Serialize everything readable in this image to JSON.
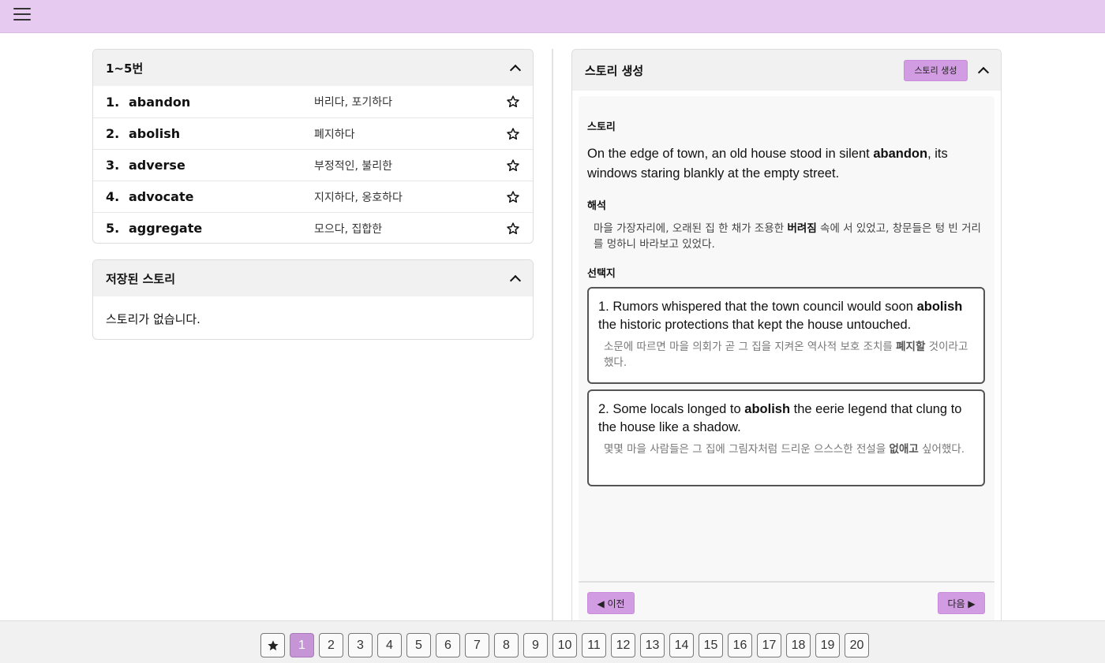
{
  "header": {
    "menu_icon": "hamburger-menu-icon"
  },
  "word_section": {
    "title": "1~5번",
    "words": [
      {
        "num": "1.",
        "word": "abandon",
        "meaning": "버리다, 포기하다"
      },
      {
        "num": "2.",
        "word": "abolish",
        "meaning": "폐지하다"
      },
      {
        "num": "3.",
        "word": "adverse",
        "meaning": "부정적인, 불리한"
      },
      {
        "num": "4.",
        "word": "advocate",
        "meaning": "지지하다, 옹호하다"
      },
      {
        "num": "5.",
        "word": "aggregate",
        "meaning": "모으다, 집합한"
      }
    ]
  },
  "saved_section": {
    "title": "저장된 스토리",
    "empty_text": "스토리가 없습니다."
  },
  "story_panel": {
    "title": "스토리 생성",
    "generate_button": "스토리 생성",
    "story_label": "스토리",
    "story": {
      "before": "On the edge of town, an old house stood in silent ",
      "bold": "abandon",
      "after": ", its windows staring blankly at the empty street."
    },
    "translation_label": "해석",
    "translation": {
      "before": "마을 가장자리에, 오래된 집 한 채가 조용한 ",
      "bold": "버려짐",
      "after": " 속에 서 있었고, 창문들은 텅 빈 거리를 멍하니 바라보고 있었다."
    },
    "choices_label": "선택지",
    "choices": [
      {
        "en_before": "1. Rumors whispered that the town council would soon ",
        "en_bold": "abolish",
        "en_after": " the historic protections that kept the house untouched.",
        "ko_before": "소문에 따르면 마을 의회가 곧 그 집을 지켜온 역사적 보호 조치를 ",
        "ko_bold": "폐지할",
        "ko_after": " 것이라고 했다."
      },
      {
        "en_before": "2. Some locals longed to ",
        "en_bold": "abolish",
        "en_after": " the eerie legend that clung to the house like a shadow.",
        "ko_before": "몇몇 마을 사람들은 그 집에 그림자처럼 드리운 으스스한 전설을 ",
        "ko_bold": "없애고",
        "ko_after": " 싶어했다."
      }
    ],
    "prev_button": "◀ 이전",
    "next_button": "다음 ▶"
  },
  "pagination": {
    "favorites_icon": "star-filled-icon",
    "active_page": "1",
    "pages": [
      "1",
      "2",
      "3",
      "4",
      "5",
      "6",
      "7",
      "8",
      "9",
      "10",
      "11",
      "12",
      "13",
      "14",
      "15",
      "16",
      "17",
      "18",
      "19",
      "20"
    ]
  },
  "colors": {
    "header_bg": "#e6caef",
    "accent": "#d29ce3",
    "active_page": "#c595d6"
  }
}
